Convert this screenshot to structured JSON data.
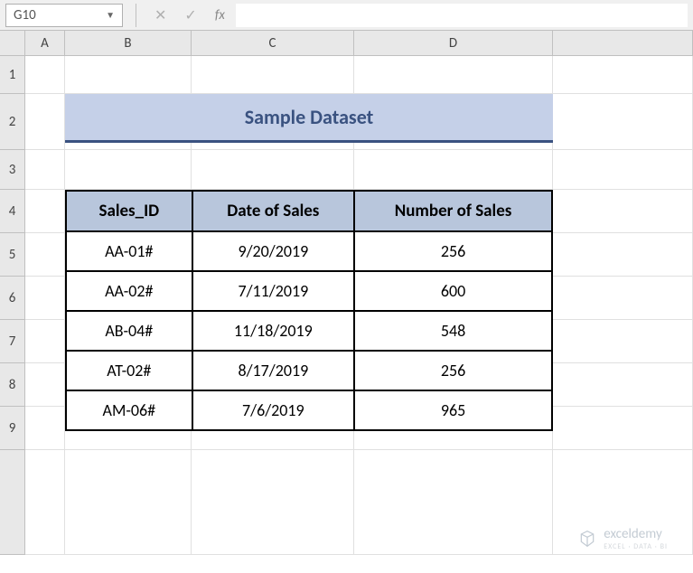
{
  "formula_bar": {
    "cell_reference": "G10",
    "fx_label": "fx",
    "formula_value": ""
  },
  "columns": [
    "A",
    "B",
    "C",
    "D"
  ],
  "rows": [
    "1",
    "2",
    "3",
    "4",
    "5",
    "6",
    "7",
    "8",
    "9"
  ],
  "title": "Sample Dataset",
  "table": {
    "headers": [
      "Sales_ID",
      "Date of Sales",
      "Number of Sales"
    ],
    "rows": [
      [
        "AA-01#",
        "9/20/2019",
        "256"
      ],
      [
        "AA-02#",
        "7/11/2019",
        "600"
      ],
      [
        "AB-04#",
        "11/18/2019",
        "548"
      ],
      [
        "AT-02#",
        "8/17/2019",
        "256"
      ],
      [
        "AM-06#",
        "7/6/2019",
        "965"
      ]
    ]
  },
  "watermark": {
    "name": "exceldemy",
    "tagline": "EXCEL · DATA · BI"
  }
}
